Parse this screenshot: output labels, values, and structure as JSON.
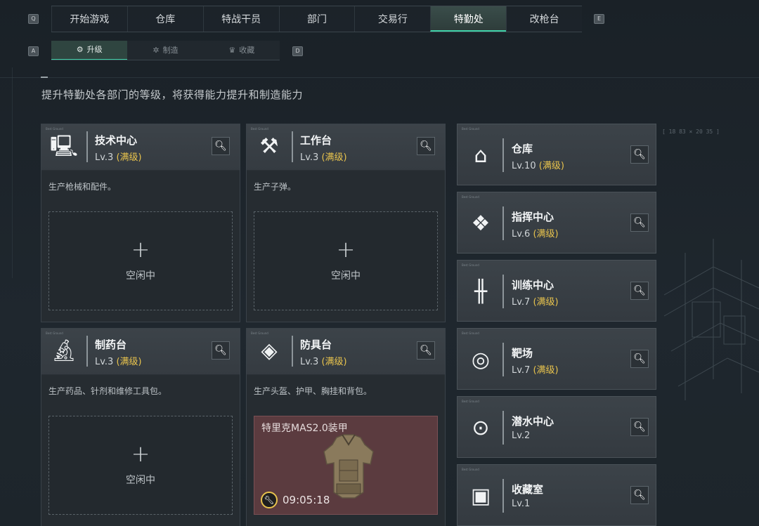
{
  "keys": {
    "left_top": "Q",
    "right_top": "E",
    "left_sub": "A",
    "right_sub": "D"
  },
  "top_tabs": [
    "开始游戏",
    "仓库",
    "特战干员",
    "部门",
    "交易行",
    "特勤处",
    "改枪台"
  ],
  "active_top_tab": "特勤处",
  "sub_tabs": [
    {
      "label": "升级",
      "icon": "upgrade-icon"
    },
    {
      "label": "制造",
      "icon": "gear-icon"
    },
    {
      "label": "收藏",
      "icon": "trophy-icon"
    }
  ],
  "description": "提升特勤处各部门的等级，将获得能力提升和制造能力",
  "coord_readout": "[ 18 83 × 20 35 ]",
  "tiny_label": "Best Ground",
  "colors": {
    "accent": "#3fd1a8",
    "max_level": "#e8c34d",
    "crafting_bg": "#5b3b3f"
  },
  "workstations": [
    {
      "name": "技术中心",
      "level": "Lv.3",
      "max": "(满级)",
      "icon": "monitor-icon",
      "desc": "生产枪械和配件。",
      "slot": "空闲中"
    },
    {
      "name": "工作台",
      "level": "Lv.3",
      "max": "(满级)",
      "icon": "tools-icon",
      "desc": "生产子弹。",
      "slot": "空闲中"
    },
    {
      "name": "制药台",
      "level": "Lv.3",
      "max": "(满级)",
      "icon": "microscope-icon",
      "desc": "生产药品、针剂和维修工具包。",
      "slot": "空闲中"
    },
    {
      "name": "防具台",
      "level": "Lv.3",
      "max": "(满级)",
      "icon": "armor-boxes-icon",
      "desc": "生产头盔、护甲、胸挂和背包。",
      "crafting": {
        "item": "特里克MAS2.0装甲",
        "time": "09:05:18"
      }
    }
  ],
  "departments": [
    {
      "name": "仓库",
      "level": "Lv.10",
      "max": "(满级)",
      "icon": "warehouse-icon"
    },
    {
      "name": "指挥中心",
      "level": "Lv.6",
      "max": "(满级)",
      "icon": "command-icon"
    },
    {
      "name": "训练中心",
      "level": "Lv.7",
      "max": "(满级)",
      "icon": "dumbbell-icon"
    },
    {
      "name": "靶场",
      "level": "Lv.7",
      "max": "(满级)",
      "icon": "target-icon"
    },
    {
      "name": "潜水中心",
      "level": "Lv.2",
      "max": "",
      "icon": "dive-mask-icon"
    },
    {
      "name": "收藏室",
      "level": "Lv.1",
      "max": "",
      "icon": "collection-icon"
    }
  ]
}
